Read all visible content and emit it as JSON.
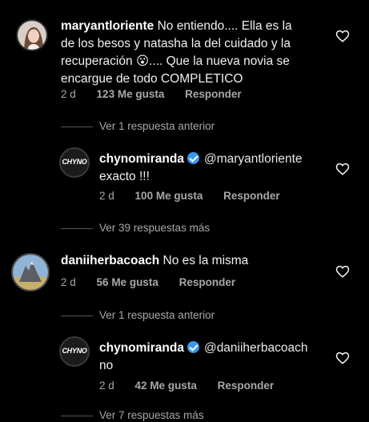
{
  "comments": [
    {
      "username": "maryantloriente",
      "text": "No entiendo.... Ella es la de los besos y natasha la del cuidado y la recuperación 😮.... Que la nueva novia se encargue de todo COMPLETICO",
      "text_line1": "No entiendo.... Ella es la",
      "text_line2": "de los besos y natasha la del cuidado y la",
      "text_line3a": "recuperación",
      "emoji": "😮",
      "text_line3b": ".... Que la nueva novia se",
      "text_line4": "encargue de todo COMPLETICO",
      "time": "2 d",
      "likes": "123 Me gusta",
      "reply": "Responder",
      "avatar_icon": "woman-avatar"
    },
    {
      "thread_toggle": "Ver 1 respuesta anterior"
    },
    {
      "username": "chynomiranda",
      "verified": true,
      "mention": "@maryantloriente",
      "text": "exacto !!!",
      "time": "2 d",
      "likes": "100 Me gusta",
      "reply": "Responder",
      "avatar_logo": "CHYNO"
    },
    {
      "thread_toggle": "Ver 39 respuestas más"
    },
    {
      "username": "daniiherbacoach",
      "text": "No es la misma",
      "time": "2 d",
      "likes": "56 Me gusta",
      "reply": "Responder",
      "avatar_icon": "mountain-avatar"
    },
    {
      "thread_toggle": "Ver 1 respuesta anterior"
    },
    {
      "username": "chynomiranda",
      "verified": true,
      "mention": "@daniiherbacoach",
      "text": "no",
      "time": "2 d",
      "likes": "42 Me gusta",
      "reply": "Responder",
      "avatar_logo": "CHYNO"
    },
    {
      "thread_toggle": "Ver 7 respuestas más"
    }
  ],
  "colors": {
    "background": "#000000",
    "text": "#f5f5f5",
    "muted": "#a8a8a8",
    "verified": "#3897f0"
  }
}
